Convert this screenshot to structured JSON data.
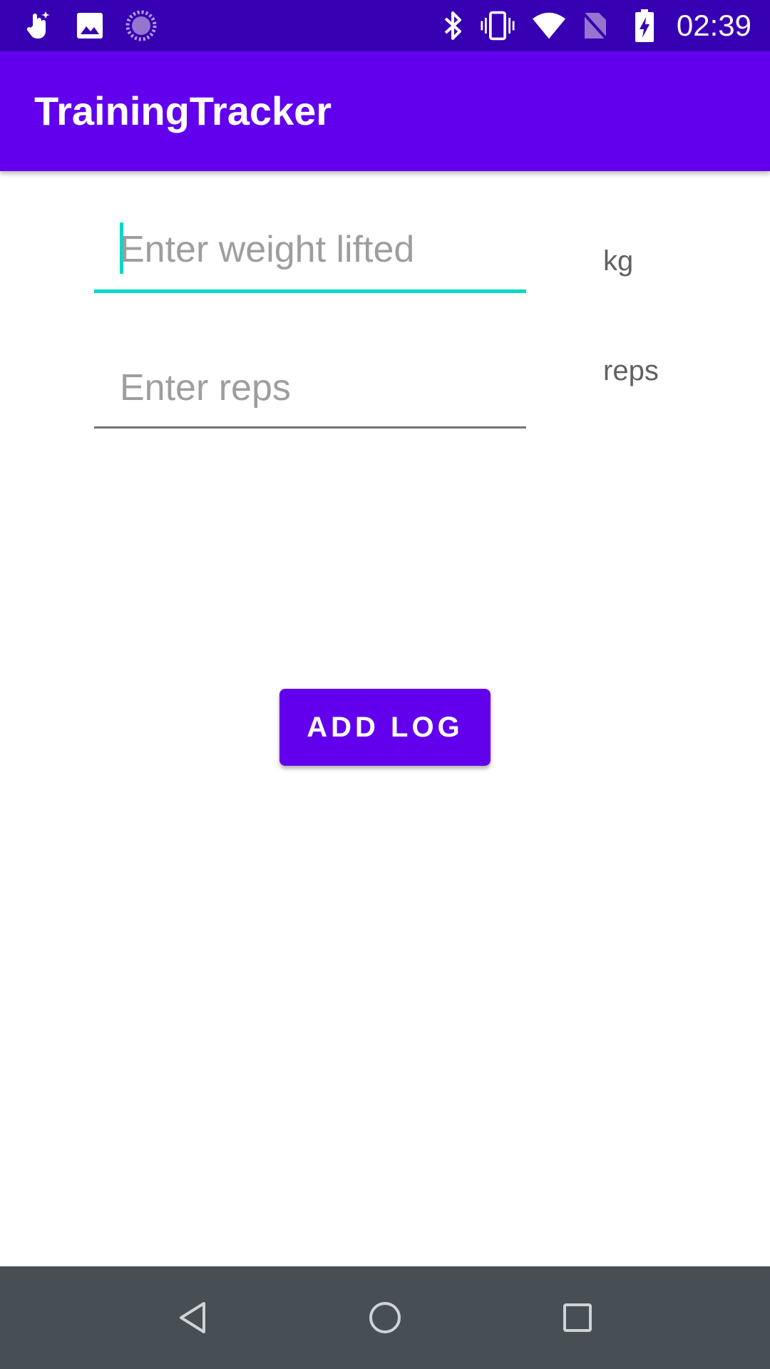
{
  "status_bar": {
    "time": "02:39",
    "left_icons": [
      "gesture-icon",
      "image-icon",
      "sync-icon"
    ],
    "right_icons": [
      "bluetooth-icon",
      "vibrate-icon",
      "wifi-icon",
      "no-sim-icon",
      "battery-charging-icon"
    ]
  },
  "app_bar": {
    "title": "TrainingTracker"
  },
  "form": {
    "weight": {
      "placeholder": "Enter weight lifted",
      "unit": "kg"
    },
    "reps": {
      "placeholder": "Enter reps",
      "unit": "reps"
    },
    "add_button_label": "ADD LOG"
  },
  "nav_bar": {
    "buttons": [
      "back-icon",
      "home-icon",
      "recents-icon"
    ]
  },
  "colors": {
    "status_bar": "#3700b3",
    "primary": "#6200ee",
    "accent": "#03dac5",
    "nav_bar": "#474f55"
  }
}
